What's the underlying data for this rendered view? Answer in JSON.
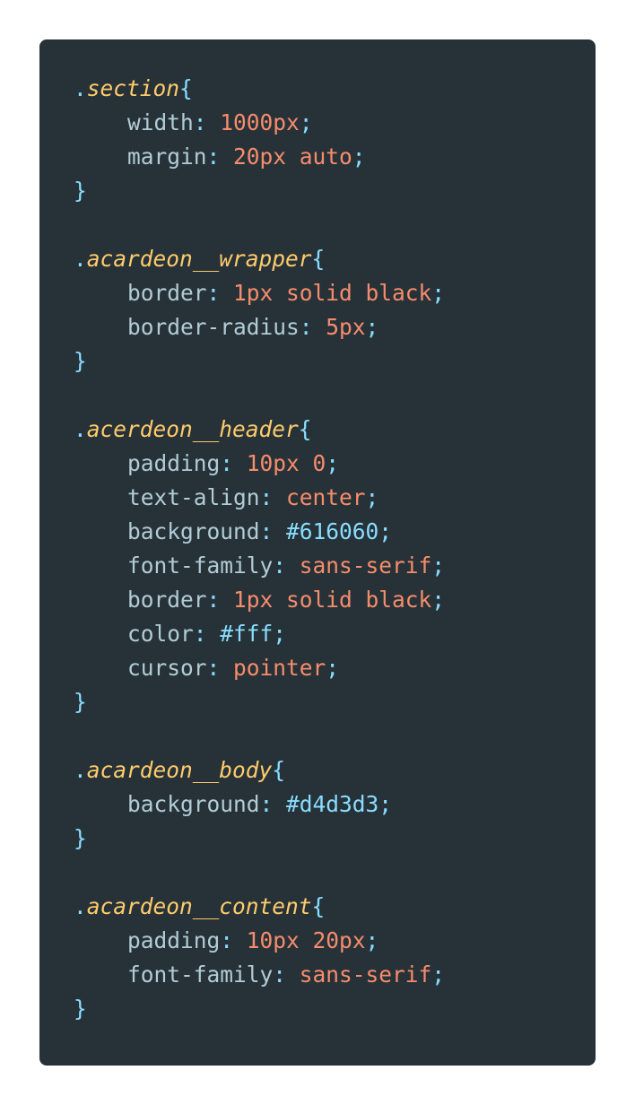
{
  "rules": [
    {
      "selector": "section",
      "declarations": [
        {
          "property": "width",
          "value": "1000px",
          "kind": "val"
        },
        {
          "property": "margin",
          "value": "20px auto",
          "kind": "val"
        }
      ]
    },
    {
      "selector": "acardeon__wrapper",
      "declarations": [
        {
          "property": "border",
          "value": "1px solid black",
          "kind": "val"
        },
        {
          "property": "border-radius",
          "value": "5px",
          "kind": "val"
        }
      ]
    },
    {
      "selector": "acerdeon__header",
      "declarations": [
        {
          "property": "padding",
          "value": "10px 0",
          "kind": "val"
        },
        {
          "property": "text-align",
          "value": "center",
          "kind": "val"
        },
        {
          "property": "background",
          "value": "#616060",
          "kind": "hex"
        },
        {
          "property": "font-family",
          "value": "sans-serif",
          "kind": "val"
        },
        {
          "property": "border",
          "value": "1px solid black",
          "kind": "val"
        },
        {
          "property": "color",
          "value": "#fff",
          "kind": "hex"
        },
        {
          "property": "cursor",
          "value": "pointer",
          "kind": "val"
        }
      ]
    },
    {
      "selector": "acardeon__body",
      "declarations": [
        {
          "property": "background",
          "value": "#d4d3d3",
          "kind": "hex"
        }
      ]
    },
    {
      "selector": "acardeon__content",
      "declarations": [
        {
          "property": "padding",
          "value": "10px 20px",
          "kind": "val"
        },
        {
          "property": "font-family",
          "value": "sans-serif",
          "kind": "val"
        }
      ]
    }
  ],
  "colors": {
    "background": "#263238",
    "selector": "#ffcb6b",
    "punctuation": "#89ddff",
    "property": "#b2ccd6",
    "value": "#f78c6c",
    "hex": "#89ddff"
  }
}
